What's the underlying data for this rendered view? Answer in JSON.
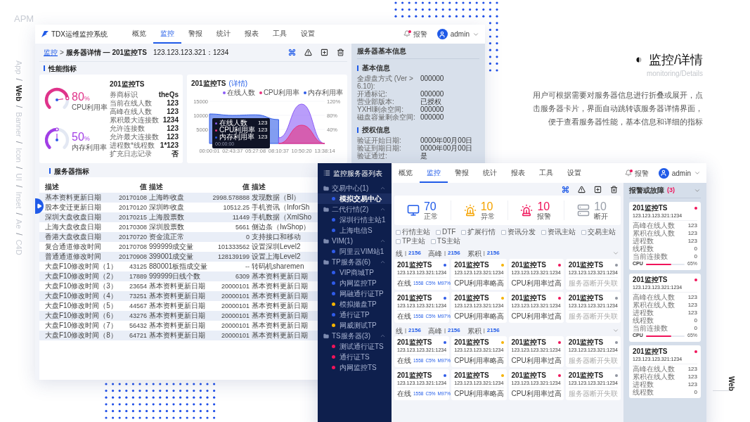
{
  "side_nav": {
    "brand": "APM",
    "separator": "/",
    "items": [
      {
        "label": "App",
        "selected": false
      },
      {
        "label": "Web",
        "selected": true
      },
      {
        "label": "Banner",
        "selected": false
      },
      {
        "label": "Icon",
        "selected": false
      },
      {
        "label": "UI",
        "selected": false
      },
      {
        "label": "Inset",
        "selected": false
      },
      {
        "label": "Ae",
        "selected": false
      },
      {
        "label": "C4D",
        "selected": false
      }
    ]
  },
  "headline": {
    "title": "监控/详情",
    "subtitle": "monitoring/Details",
    "description": "用户可根据需要对服务器信息进行折叠或展开，点击服务器卡片，界面自动跳转该服务器详情界面，便于查看服务器性能，基本信息和详细的指标"
  },
  "corner_label": "Web",
  "detail_window": {
    "logo_text": "TDX运维监控系统",
    "tabs": [
      {
        "label": "概览",
        "selected": false
      },
      {
        "label": "监控",
        "selected": true
      },
      {
        "label": "警报",
        "selected": false
      },
      {
        "label": "统计",
        "selected": false
      },
      {
        "label": "报表",
        "selected": false
      },
      {
        "label": "工具",
        "selected": false
      },
      {
        "label": "设置",
        "selected": false
      }
    ],
    "alert": "报警",
    "user": "admin",
    "breadcrumb": {
      "link": "监控",
      "separator": ">",
      "current": "服务器详情 — 201监控TS",
      "address": "123.123.123.321：1234"
    },
    "performance": {
      "title": "性能指标",
      "server_name": "201监控TS",
      "gauges": [
        {
          "value": "80",
          "unit": "%",
          "label": "CPU利用率",
          "color": "#e0338a"
        },
        {
          "value": "50",
          "unit": "%",
          "label": "内存利用率",
          "color": "#a23ee6"
        }
      ],
      "stats": [
        {
          "label": "券商标识",
          "value": "theQs"
        },
        {
          "label": "当前在线人数",
          "value": "123"
        },
        {
          "label": "高峰在线人数",
          "value": "123"
        },
        {
          "label": "累积最大连接数",
          "value": "1234"
        },
        {
          "label": "允许连接数",
          "value": "123"
        },
        {
          "label": "允许最大连接数",
          "value": "123"
        },
        {
          "label": "进程数*线程数",
          "value": "1*123"
        },
        {
          "label": "扩充日志记录",
          "value": "否"
        }
      ]
    },
    "chart": {
      "title": "201监控TS",
      "link": "(详情)",
      "right_ticks": [
        "120%",
        "80%",
        "40%"
      ],
      "tooltip": {
        "rows": [
          {
            "label": "在线人数",
            "value": "123"
          },
          {
            "label": "CPU利用率",
            "value": "123"
          },
          {
            "label": "内存利用率",
            "value": "123"
          }
        ],
        "time": "00:00:00"
      },
      "chart_data": {
        "type": "area",
        "categories": [
          "00:00:01",
          "02:43:37",
          "05:27:08",
          "08:10:37",
          "10:50:20",
          "13:38:14"
        ],
        "series": [
          {
            "name": "在线人数",
            "color": "#8b5cf6",
            "values": [
              null,
              null,
              null,
              2000,
              14000,
              0
            ]
          },
          {
            "name": "CPU利用率",
            "color": "#e8337f",
            "values": [
              null,
              null,
              null,
              0,
              6500,
              0
            ]
          },
          {
            "name": "内存利用率",
            "color": "#2f5be8",
            "values": [
              10500,
              10000,
              10200,
              8500,
              null,
              null
            ]
          }
        ],
        "ylim": [
          0,
          15000
        ],
        "yticks": [
          5000,
          10000,
          15000
        ],
        "legend": "top-right"
      }
    },
    "info_panel": {
      "title": "服务器基本信息",
      "sections": [
        {
          "title": "基本信息",
          "rows": [
            {
              "label": "全虚盘方式 (Ver > 6.10):",
              "value": "000000"
            },
            {
              "label": "开通标记:",
              "value": "000000"
            },
            {
              "label": "营业部版本:",
              "value": "已授权"
            },
            {
              "label": "YXHI剩余空间:",
              "value": "000000"
            },
            {
              "label": "磁盘容量剩余空间:",
              "value": "000000"
            }
          ]
        },
        {
          "title": "授权信息",
          "rows": [
            {
              "label": "验证开始日期:",
              "value": "0000年00月00日"
            },
            {
              "label": "验证到期日期:",
              "value": "0000年00月00日"
            },
            {
              "label": "验证通过:",
              "value": "是"
            }
          ]
        }
      ]
    },
    "metrics": {
      "title": "服务器指标",
      "columns": [
        "描述",
        "值",
        "描述",
        "值",
        "描述"
      ],
      "rows": [
        [
          "基本资料更新日期",
          "20170108",
          "上海昨收盘",
          "2998.578888",
          "发现数据（BI）"
        ],
        [
          "股本变迁更新日期",
          "20170120",
          "深圳昨收盘",
          "10512.25",
          "手机资讯（InforSh"
        ],
        [
          "深圳大盘收盘日期",
          "20170215",
          "上海股票数",
          "11449",
          "手机数据（XmlSho"
        ],
        [
          "上海大盘收盘日期",
          "20170308",
          "深圳股票数",
          "5661",
          "侧边条（IwShop）"
        ],
        [
          "香港大盘收盘日期",
          "20170720",
          "资金流正常",
          "0",
          "支持接口和移动"
        ],
        [
          "复合通道修改时间",
          "20170708",
          "999999成交量",
          "101333562",
          "设置深圳Level2"
        ],
        [
          "普通通道修改时间",
          "20170908",
          "399001成交量",
          "128139199",
          "设置上海Level2"
        ],
        [
          "大盘F10修改时间（1）",
          "43125",
          "880001板指成交量",
          "--",
          "转码机sharemen"
        ],
        [
          "大盘F10修改时间（2）",
          "17889",
          "999999日线个数",
          "6309",
          "基本资料更新日期"
        ],
        [
          "大盘F10修改时间（3）",
          "23654",
          "基本资料更新日期",
          "20000101",
          "基本资料更新日期"
        ],
        [
          "大盘F10修改时间（4）",
          "73251",
          "基本资料更新日期",
          "20000101",
          "基本资料更新日期"
        ],
        [
          "大盘F10修改时间（5）",
          "44567",
          "基本资料更新日期",
          "20000101",
          "基本资料更新日期"
        ],
        [
          "大盘F10修改时间（6）",
          "43276",
          "基本资料更新日期",
          "20000101",
          "基本资料更新日期"
        ],
        [
          "大盘F10修改时间（7）",
          "56432",
          "基本资料更新日期",
          "20000101",
          "基本资料更新日期"
        ],
        [
          "大盘F10修改时间（8）",
          "64721",
          "基本资料更新日期",
          "20000101",
          "基本资料更新日期"
        ]
      ]
    }
  },
  "list_window": {
    "sidebar": {
      "title": "监控服务器列表",
      "groups": [
        {
          "label": "交易中心(1)",
          "expanded": true,
          "children": [
            {
              "label": "模拟交易中心",
              "color": "#2f5be8",
              "selected": true
            }
          ]
        },
        {
          "label": "二代行情(2)",
          "expanded": true,
          "children": [
            {
              "label": "深圳行情主站1",
              "color": "#2f5be8",
              "selected": false
            },
            {
              "label": "上海电信S",
              "color": "#2f5be8",
              "selected": false
            }
          ]
        },
        {
          "label": "VIM(1)",
          "expanded": true,
          "children": [
            {
              "label": "阿里云VIM站1",
              "color": "#2f5be8",
              "selected": false
            }
          ]
        },
        {
          "label": "TP服务器(6)",
          "expanded": true,
          "children": [
            {
              "label": "VIP商城TP",
              "color": "#2f5be8",
              "selected": false
            },
            {
              "label": "内网监控TP",
              "color": "#2f5be8",
              "selected": false
            },
            {
              "label": "网融通行证TP",
              "color": "#2f5be8",
              "selected": false
            },
            {
              "label": "模拟撮盘TP",
              "color": "#f5b301",
              "selected": false
            },
            {
              "label": "通行证TP",
              "color": "#2f5be8",
              "selected": false
            },
            {
              "label": "网威测试TP",
              "color": "#f5b301",
              "selected": false
            }
          ]
        },
        {
          "label": "TS服务器(3)",
          "expanded": true,
          "children": [
            {
              "label": "测试通行证TS",
              "color": "#f0145a",
              "selected": false
            },
            {
              "label": "通行证TS",
              "color": "#f0145a",
              "selected": false
            },
            {
              "label": "内网监控TS",
              "color": "#f0145a",
              "selected": false
            }
          ]
        }
      ]
    },
    "tabs": [
      {
        "label": "概览",
        "selected": false
      },
      {
        "label": "监控",
        "selected": true
      },
      {
        "label": "警报",
        "selected": false
      },
      {
        "label": "统计",
        "selected": false
      },
      {
        "label": "报表",
        "selected": false
      },
      {
        "label": "工具",
        "selected": false
      },
      {
        "label": "设置",
        "selected": false
      }
    ],
    "alert": "报警",
    "user": "admin",
    "summary": [
      {
        "kind": "monitor",
        "value": "70",
        "label": "正常",
        "color": "#1f5ae8"
      },
      {
        "kind": "siren",
        "value": "10",
        "label": "异常",
        "color": "#f5a300"
      },
      {
        "kind": "siren",
        "value": "10",
        "label": "报警",
        "color": "#f0145a"
      },
      {
        "kind": "server",
        "value": "10",
        "label": "断开",
        "color": "#9aa0aa"
      }
    ],
    "filters": [
      {
        "label": "行情主站",
        "checked": false
      },
      {
        "label": "DTF",
        "checked": false
      },
      {
        "label": "扩展行情",
        "checked": false
      },
      {
        "label": "资讯分发",
        "checked": false
      },
      {
        "label": "资讯主站",
        "checked": false
      },
      {
        "label": "交易主站",
        "checked": false
      },
      {
        "label": "TP主站",
        "checked": false
      },
      {
        "label": "TS主站",
        "checked": false
      }
    ],
    "groups": [
      {
        "separator": "|",
        "stats": [
          {
            "label": "线",
            "value": "2156"
          },
          {
            "label": "高峰",
            "value": "2156"
          },
          {
            "label": "累积",
            "value": "2156"
          }
        ],
        "cards": [
          {
            "name": "201监控TS",
            "address": "123.123.123.321:1234",
            "color": "#2f5be8",
            "kind": "online",
            "label": "在线",
            "values": [
              "1558",
              "C5%",
              "M97%"
            ]
          },
          {
            "name": "201监控TS",
            "address": "123.123.123.321:1234",
            "color": "#f5b301",
            "kind": "warning",
            "note": "CPU利用率略高"
          },
          {
            "name": "201监控TS",
            "address": "123.123.123.321:1234",
            "color": "#f0145a",
            "kind": "warning",
            "note": "CPU利用率过高"
          },
          {
            "name": "201监控TS",
            "address": "123.123.123.321:1234",
            "color": "#9095a0",
            "kind": "offline",
            "note": "服务器断开失联"
          },
          {
            "name": "201监控TS",
            "address": "123.123.123.321:1234",
            "color": "#2f5be8",
            "kind": "online",
            "label": "在线",
            "values": [
              "1558",
              "C5%",
              "M97%"
            ]
          },
          {
            "name": "201监控TS",
            "address": "123.123.123.321:1234",
            "color": "#f5b301",
            "kind": "warning",
            "note": "CPU利用率略高"
          },
          {
            "name": "201监控TS",
            "address": "123.123.123.321:1234",
            "color": "#f0145a",
            "kind": "warning",
            "note": "CPU利用率过高"
          },
          {
            "name": "201监控TS",
            "address": "123.123.123.321:1234",
            "color": "#9095a0",
            "kind": "offline",
            "note": "服务器断开失联"
          }
        ]
      },
      {
        "separator": "|",
        "stats": [
          {
            "label": "线",
            "value": "2156"
          },
          {
            "label": "高峰",
            "value": "2156"
          },
          {
            "label": "累积",
            "value": "2156"
          }
        ],
        "cards": [
          {
            "name": "201监控TS",
            "address": "123.123.123.321:1234",
            "color": "#2f5be8",
            "kind": "online",
            "label": "在线",
            "values": [
              "1558",
              "C5%",
              "M97%"
            ]
          },
          {
            "name": "201监控TS",
            "address": "123.123.123.321:1234",
            "color": "#f5b301",
            "kind": "warning",
            "note": "CPU利用率略高"
          },
          {
            "name": "201监控TS",
            "address": "123.123.123.321:1234",
            "color": "#f0145a",
            "kind": "warning",
            "note": "CPU利用率过高"
          },
          {
            "name": "201监控TS",
            "address": "123.123.123.321:1234",
            "color": "#9095a0",
            "kind": "offline",
            "note": "服务器断开失联"
          },
          {
            "name": "201监控TS",
            "address": "123.123.123.321:1234",
            "color": "#2f5be8",
            "kind": "online",
            "label": "在线",
            "values": [
              "1558",
              "C5%",
              "M97%"
            ]
          },
          {
            "name": "201监控TS",
            "address": "123.123.123.321:1234",
            "color": "#f5b301",
            "kind": "warning",
            "note": "CPU利用率略高"
          },
          {
            "name": "201监控TS",
            "address": "123.123.123.321:1234",
            "color": "#f0145a",
            "kind": "warning",
            "note": "CPU利用率过高"
          },
          {
            "name": "201监控TS",
            "address": "123.123.123.321:1234",
            "color": "#9095a0",
            "kind": "offline",
            "note": "服务器断开失联"
          }
        ]
      }
    ],
    "alerts_panel": {
      "title": "报警或故障",
      "count": "(3)",
      "cards": [
        {
          "name": "201监控TS",
          "address": "123.123.123.321:1234",
          "color": "#f0145a",
          "rows": [
            {
              "label": "高峰在线人数",
              "value": "123"
            },
            {
              "label": "累积在线人数",
              "value": "123"
            },
            {
              "label": "进程数",
              "value": "123"
            },
            {
              "label": "线程数",
              "value": "0"
            },
            {
              "label": "当前连接数",
              "value": "0"
            }
          ],
          "cpu": {
            "label": "CPU",
            "level": 0.65,
            "reading": "65%"
          }
        },
        {
          "name": "201监控TS",
          "address": "123.123.123.321:1234",
          "color": "#f0145a",
          "rows": [
            {
              "label": "高峰在线人数",
              "value": "123"
            },
            {
              "label": "累积在线人数",
              "value": "123"
            },
            {
              "label": "进程数",
              "value": "123"
            },
            {
              "label": "线程数",
              "value": "0"
            },
            {
              "label": "当前连接数",
              "value": "0"
            }
          ],
          "cpu": {
            "label": "CPU",
            "level": 0.65,
            "reading": "65%"
          }
        },
        {
          "name": "201监控TS",
          "address": "123.123.123.321:1234",
          "color": "#f0145a",
          "rows": [
            {
              "label": "高峰在线人数",
              "value": "123"
            },
            {
              "label": "累积在线人数",
              "value": "123"
            },
            {
              "label": "进程数",
              "value": "123"
            },
            {
              "label": "线程数",
              "value": "0"
            }
          ]
        }
      ]
    }
  }
}
